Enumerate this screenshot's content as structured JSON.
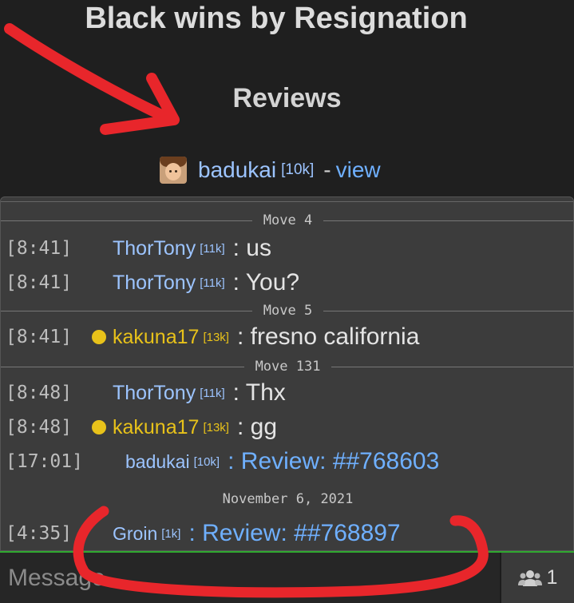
{
  "header": {
    "result_text": "Black wins by Resignation",
    "reviews_title": "Reviews"
  },
  "reviewer": {
    "name": "badukai",
    "rank": "[10k]",
    "separator": "-",
    "view_label": "view",
    "avatar_icon": "avatar-icon"
  },
  "chat": {
    "sections": [
      {
        "divider": "Move 4",
        "lines": [
          {
            "time": "[8:41]",
            "user": "ThorTony",
            "rank": "[11k]",
            "message": ": us"
          },
          {
            "time": "[8:41]",
            "user": "ThorTony",
            "rank": "[11k]",
            "message": ": You?"
          }
        ]
      },
      {
        "divider": "Move 5",
        "lines": [
          {
            "time": "[8:41]",
            "user": "kakuna17",
            "rank": "[13k]",
            "message": ": fresno california"
          }
        ]
      },
      {
        "divider": "Move 131",
        "lines": [
          {
            "time": "[8:48]",
            "user": "ThorTony",
            "rank": "[11k]",
            "message": ": Thx"
          },
          {
            "time": "[8:48]",
            "user": "kakuna17",
            "rank": "[13k]",
            "message": ": gg"
          },
          {
            "time": "[17:01]",
            "user": "badukai",
            "rank": "[10k]",
            "message": ": Review: ##768603"
          }
        ]
      },
      {
        "divider": "November 6, 2021",
        "lines": [
          {
            "time": "[4:35]",
            "user": "Groin",
            "rank": "[1k]",
            "message": ": Review: ##768897"
          }
        ]
      }
    ]
  },
  "input": {
    "placeholder": "Message"
  },
  "users_button": {
    "count": "1",
    "icon": "users-icon"
  },
  "colors": {
    "background": "#1f1f1f",
    "chat_panel": "#3c3c3c",
    "blue_user": "#9cc4ff",
    "gold_user": "#e8c21a",
    "link": "#6fb0ff",
    "annotation_red": "#e8262b",
    "input_border": "#2fa82f"
  }
}
